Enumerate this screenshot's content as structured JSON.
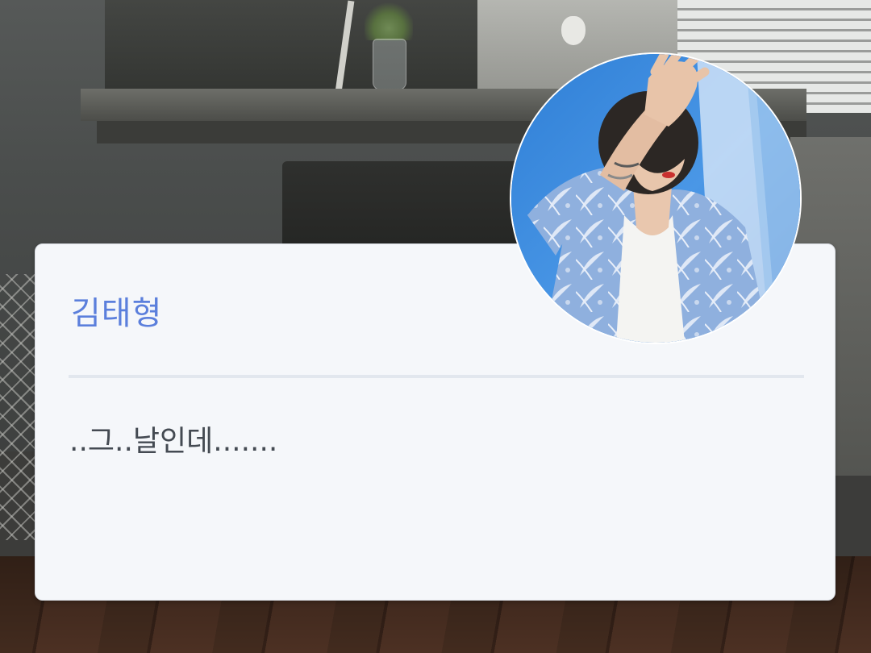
{
  "dialogue": {
    "speaker_name": "김태형",
    "message": "..그..날인데......."
  },
  "colors": {
    "name_accent": "#5b7fdc",
    "card_background": "#f5f7fa",
    "text_color": "#444a52",
    "divider": "#e2e7ee"
  },
  "avatar": {
    "icon": "character-portrait-avatar"
  }
}
